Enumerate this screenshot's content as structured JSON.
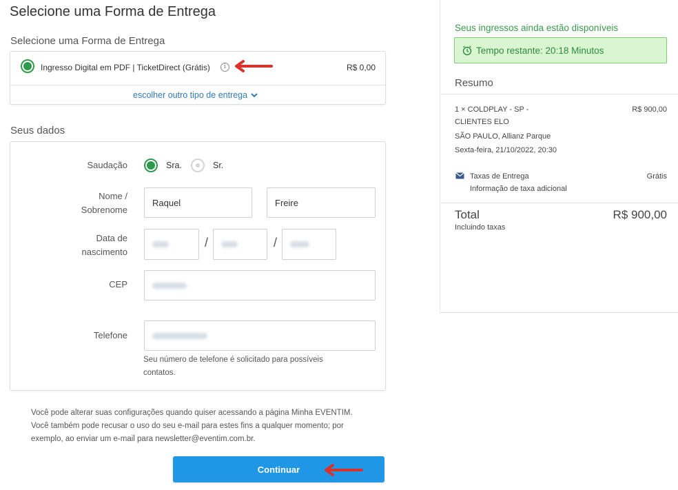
{
  "page": {
    "title": "Selecione uma Forma de Entrega"
  },
  "delivery": {
    "section_title": "Selecione uma Forma de Entrega",
    "option_label": "Ingresso Digital em PDF | TicketDirect (Grátis)",
    "option_price": "R$ 0,00",
    "info_icon": "info-circle-icon",
    "change_link": "escolher outro tipo de entrega",
    "change_icon": "chevron-down-icon"
  },
  "personal": {
    "section_title": "Seus dados",
    "salutation_label": "Saudação",
    "salutation_options": [
      {
        "label": "Sra.",
        "selected": true
      },
      {
        "label": "Sr.",
        "selected": false
      }
    ],
    "name_label_line1": "Nome /",
    "name_label_line2": "Sobrenome",
    "first_name": "Raquel",
    "last_name": "Freire",
    "birth_label_line1": "Data de",
    "birth_label_line2": "nascimento",
    "date_separator": "/",
    "cep_label": "CEP",
    "phone_label": "Telefone",
    "phone_hint_line1": "Seu número de telefone é solicitado para possíveis",
    "phone_hint_line2": "contatos."
  },
  "privacy": {
    "line1": "Você pode alterar suas configurações quando quiser acessando a página Minha EVENTIM.",
    "line2": "Você também pode recusar o uso do seu e-mail para estes fins a qualquer momento; por",
    "line3": "exemplo, ao enviar um e-mail para newsletter@eventim.com.br."
  },
  "actions": {
    "continue_label": "Continuar"
  },
  "sidebar": {
    "availability": "Seus ingressos ainda estão disponíveis",
    "timer_icon": "alarm-clock-icon",
    "timer_text": "Tempo restante: 20:18 Minutos",
    "summary_title": "Resumo",
    "item_line1": "1 × COLDPLAY - SP -",
    "item_line2": "CLIENTES ELO",
    "item_price": "R$ 900,00",
    "venue": "SÃO PAULO, Allianz Parque",
    "date": "Sexta-feira, 21/10/2022, 20:30",
    "fee_icon": "envelope-icon",
    "fee_label": "Taxas de Entrega",
    "fee_value": "Grátis",
    "fee_note": "Informação de taxa adicional",
    "total_label": "Total",
    "total_value": "R$ 900,00",
    "total_note": "Incluindo taxas"
  },
  "colors": {
    "accent_green": "#2d9a4a",
    "button_blue": "#2096e6",
    "link_blue": "#2f7ab6",
    "arrow_red": "#d8322a",
    "timer_bg": "#d9f5d2"
  }
}
